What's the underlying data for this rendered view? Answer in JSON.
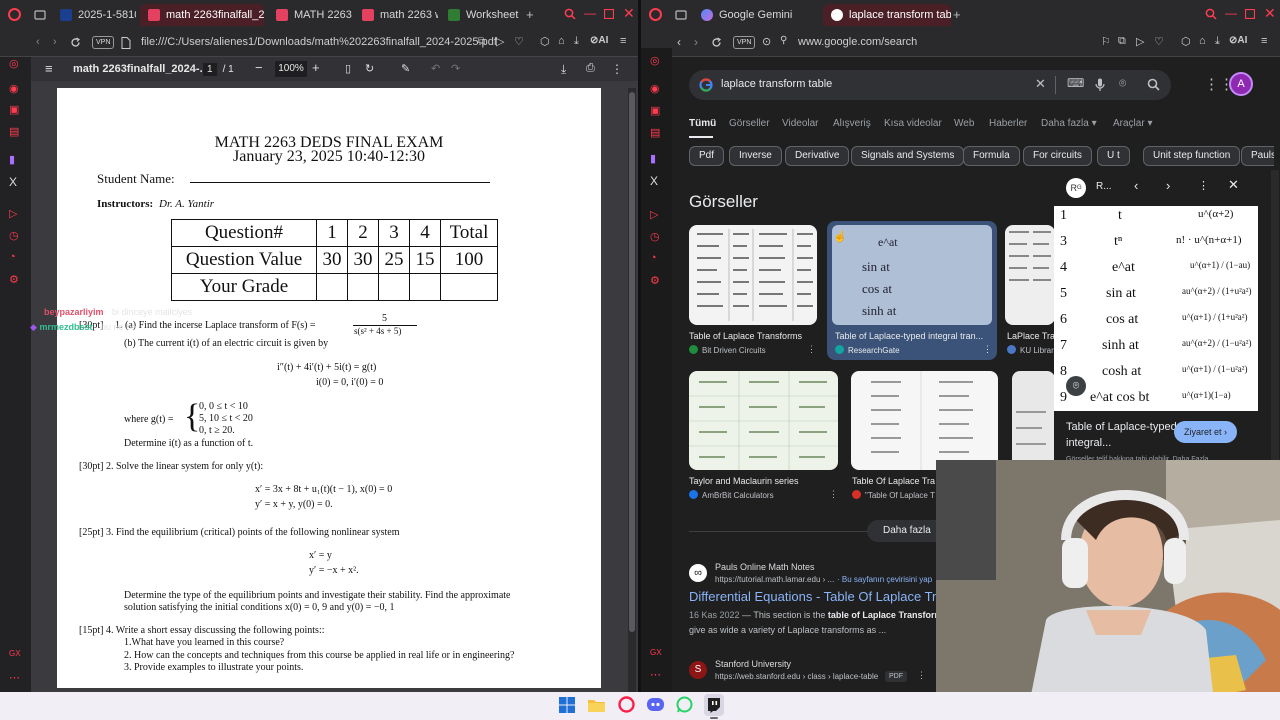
{
  "left_browser": {
    "tabs": [
      {
        "label": "2025-1-58109",
        "active": false
      },
      {
        "label": "math 2263finalfall_2024-2",
        "active": true
      },
      {
        "label": "MATH 2263-Fi",
        "active": false
      },
      {
        "label": "math 2263 wo",
        "active": false
      },
      {
        "label": "Worksheet 1",
        "active": false
      }
    ],
    "vpn_label": "VPN",
    "address": "file:///C:/Users/alienes1/Downloads/math%202263finalfall_2024-2025.pdf",
    "ai_label": "AI",
    "pdf": {
      "title": "math 2263finalfall_2024-...",
      "page_current": "1",
      "page_total": "/ 1",
      "zoom": "100%"
    }
  },
  "exam": {
    "title": "MATH 2263 DEDS  FINAL EXAM",
    "date": "January 23, 2025 10:40-12:30",
    "student_name_label": "Student Name:",
    "instructors_label": "Instructors:",
    "instructor_name": "Dr. A. Yantir",
    "grade_table": {
      "header": [
        "Question#",
        "1",
        "2",
        "3",
        "4",
        "Total"
      ],
      "values": [
        "Question Value",
        "30",
        "30",
        "25",
        "15",
        "100"
      ],
      "grade_row_label": "Your Grade"
    },
    "q1_prefix": "[30pt]",
    "q1a": "1.  (a) Find the incerse Laplace transform of F(s) =",
    "q1a_num": "5",
    "q1a_den": "s(s² + 4s + 5)",
    "q1b": "(b) The current i(t) of an electric circuit is given by",
    "q1b_eq1": "i″(t) + 4i′(t) + 5i(t) = g(t)",
    "q1b_eq2": "i(0) = 0,  i′(0) = 0",
    "q1b_where": "where g(t) =",
    "q1b_case1": "0,   0 ≤ t < 10",
    "q1b_case2": "5,   10 ≤ t < 20",
    "q1b_case3": "0,   t ≥ 20.",
    "q1b_determine": "Determine i(t) as a function of t.",
    "q2": "[30pt]  2.  Solve the linear system for only y(t):",
    "q2_eq1": "x′   =   3x + 8t + u₁(t)(t − 1),   x(0) = 0",
    "q2_eq2": "y′   =   x + y,                            y(0) = 0.",
    "q3": "[25pt]  3.  Find the equilibrium (critical) points of the following nonlinear system",
    "q3_eq1": "x′   =   y",
    "q3_eq2": "y′   =   −x + x².",
    "q3_b1": "Determine the type of the equilibrium points and investigate their stability. Find the approximate",
    "q3_b2": "solution satisfying the initial conditions x(0) = 0, 9 and y(0) = −0, 1",
    "q4": "[15pt]  4.   Write a short essay discussing the following points::",
    "q4_p1": "1.What have you learned in this course?",
    "q4_p2": "2. How can the concepts and techniques from this course be applied in real life or in engineering?",
    "q4_p3": "3. Provide examples to illustrate your points."
  },
  "chat_overlay": {
    "line1_user": "beypazarliyim",
    "line1_msg": "bi dinceye mailciyes",
    "line2_user": "mrmezdbsst",
    "line2_msg": "bu ne be"
  },
  "right_browser": {
    "tabs": [
      {
        "label": "Google Gemini",
        "active": false
      },
      {
        "label": "laplace transform table - G",
        "active": true
      }
    ],
    "vpn_label": "VPN",
    "address": "www.google.com/search",
    "ai_label": "AI",
    "search_query": "laplace transform table",
    "avatar_letter": "A",
    "nav": [
      "Tümü",
      "Görseller",
      "Videolar",
      "Alışveriş",
      "Kısa videolar",
      "Web",
      "Haberler",
      "Daha fazla ▾",
      "Araçlar ▾"
    ],
    "chips": [
      "Pdf",
      "Inverse",
      "Derivative",
      "Signals and Systems",
      "Formula",
      "For circuits",
      "U t",
      "Unit step function",
      "Pauls"
    ],
    "images_heading": "Görseller",
    "images": [
      {
        "caption": "Table of Laplace Transforms",
        "source": "Bit Driven Circuits",
        "source_color": "#1e8e3e"
      },
      {
        "caption": "Table of Laplace-typed integral tran...",
        "source": "ResearchGate",
        "source_color": "#12a5a0"
      },
      {
        "caption": "LaPlace Tra",
        "source": "KU Librar",
        "source_color": "#4a78c9"
      },
      {
        "caption": "Taylor and Maclaurin series",
        "source": "AmBrBit Calculators",
        "source_color": "#1a73e8"
      },
      {
        "caption": "Table Of Laplace Tra",
        "source": "\"Table Of Laplace T",
        "source_color": "#d93025"
      },
      {
        "caption": "",
        "source": "",
        "source_color": "#888888"
      }
    ],
    "thumb2_formulas": [
      "e^at",
      "sin at",
      "cos at",
      "sinh at"
    ],
    "more_images": "Daha fazla",
    "preview": {
      "label": "R...",
      "caption": "Table of Laplace-typed integral...",
      "visit_button": "Ziyaret et",
      "footnote": "Görseller telif hakkına tabi olabilir.  Daha Fazla",
      "rows": [
        {
          "n": "1",
          "f": "t",
          "F": "u^(α+2)"
        },
        {
          "n": "3",
          "f": "tⁿ",
          "F": "n! · u^(n+α+1)"
        },
        {
          "n": "4",
          "f": "e^at",
          "F": "u^(α+1) / (1−au)"
        },
        {
          "n": "5",
          "f": "sin at",
          "F": "au^(α+2) / (1+u²a²)"
        },
        {
          "n": "6",
          "f": "cos at",
          "F": "u^(α+1) / (1+u²a²)"
        },
        {
          "n": "7",
          "f": "sinh at",
          "F": "au^(α+2) / (1−u²a²)"
        },
        {
          "n": "8",
          "f": "cosh at",
          "F": "u^(α+1) / (1−u²a²)"
        },
        {
          "n": "9",
          "f": "e^at cos bt",
          "F": "u^(α+1)(1−a)"
        }
      ]
    },
    "results": [
      {
        "site": "Pauls Online Math Notes",
        "url": "https://tutorial.math.lamar.edu › ...",
        "translate": "Bu sayfanın çevirisini yap",
        "title": "Differential Equations - Table Of Laplace Transforms",
        "date": "16 Kas 2022",
        "snippet_pre": " — This section is the ",
        "snippet_bold": "table of Laplace Transforms",
        "snippet_line2": "give as wide a variety of Laplace transforms as ..."
      },
      {
        "site": "Stanford University",
        "url": "https://web.stanford.edu › class › laplace-table",
        "badge": "PDF"
      }
    ]
  },
  "taskbar": {
    "icons": [
      "windows-start-icon",
      "file-explorer-icon",
      "opera-gx-icon",
      "discord-icon",
      "whatsapp-icon",
      "twitch-icon"
    ]
  }
}
